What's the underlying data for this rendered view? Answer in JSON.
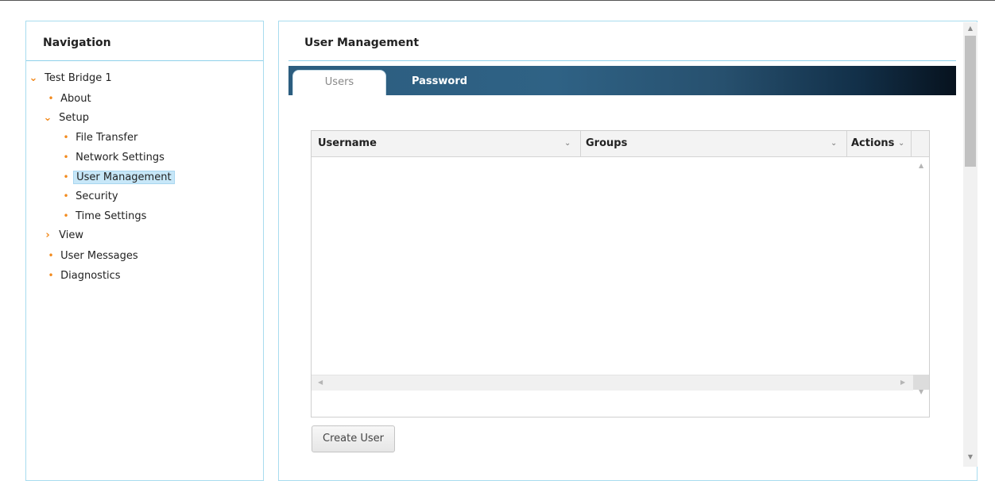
{
  "navigation": {
    "title": "Navigation",
    "root": "Test Bridge 1",
    "items": {
      "about": "About",
      "setup": "Setup",
      "file_transfer": "File Transfer",
      "network_settings": "Network Settings",
      "user_management": "User Management",
      "security": "Security",
      "time_settings": "Time Settings",
      "view": "View",
      "user_messages": "User Messages",
      "diagnostics": "Diagnostics"
    },
    "selected": "User Management"
  },
  "main": {
    "title": "User Management",
    "tabs": {
      "users": "Users",
      "password": "Password"
    },
    "active_tab": "Users"
  },
  "grid": {
    "columns": {
      "username": "Username",
      "groups": "Groups",
      "actions": "Actions"
    },
    "rows": []
  },
  "actions": {
    "create_user": "Create User"
  },
  "icons": {
    "expanded": "chevron-down-icon",
    "collapsed": "chevron-right-icon",
    "leaf": "bullet-icon",
    "sort": "caret-down-icon"
  },
  "colors": {
    "accent_orange": "#f28a1d",
    "panel_border": "#a8dcef",
    "tab_bar_start": "#2c5d7f",
    "tab_bar_end": "#07121e",
    "selected_bg": "#c7e7f8"
  }
}
